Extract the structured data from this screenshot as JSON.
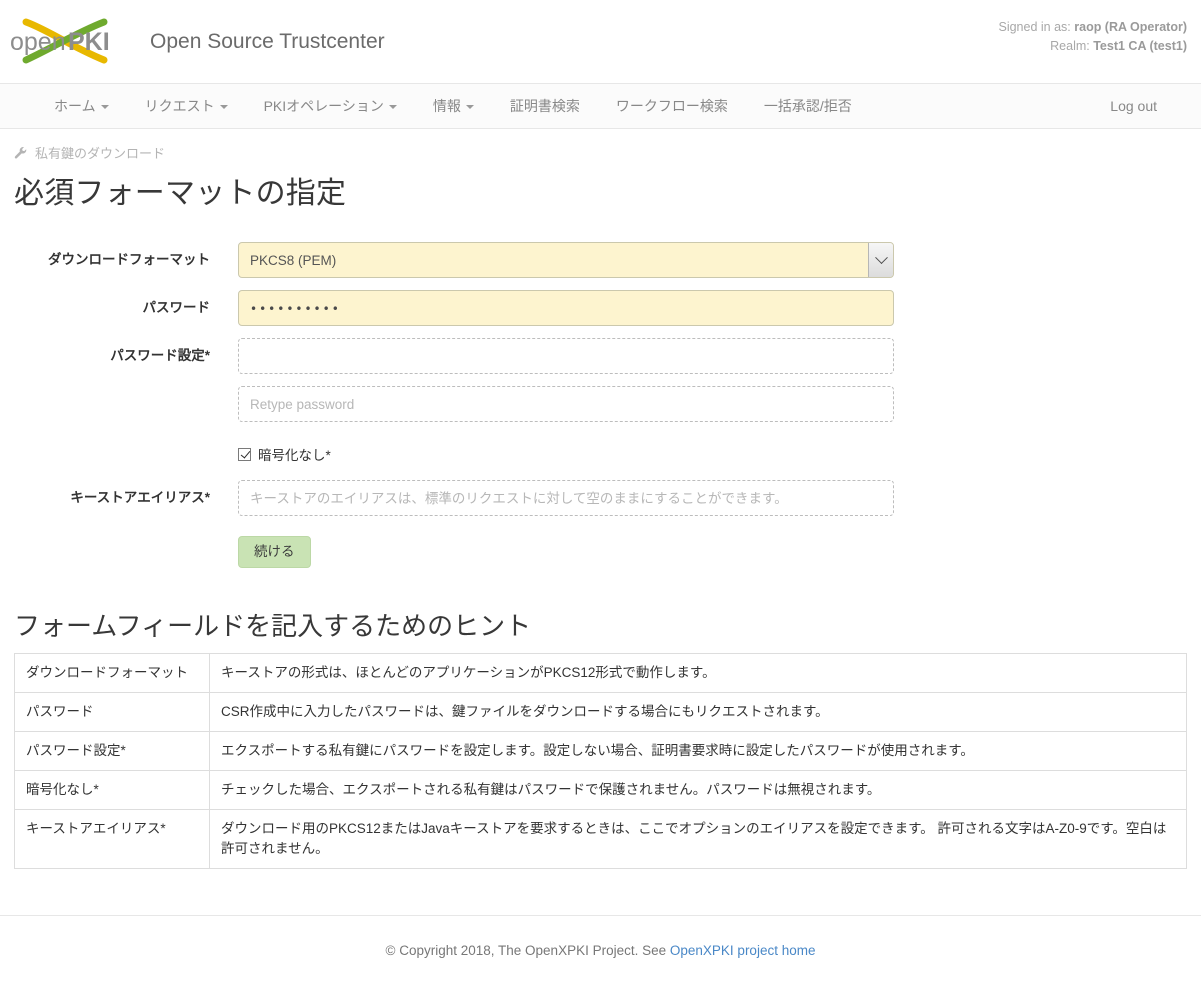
{
  "header": {
    "logo_alt": "openXPKI",
    "logo_text_open": "open",
    "logo_text_pki": "PKI",
    "brand_title": "Open Source Trustcenter",
    "signed_in_label": "Signed in as:",
    "signed_in_user": "raop (RA Operator)",
    "realm_label": "Realm:",
    "realm_value": "Test1 CA (test1)"
  },
  "nav": {
    "items": [
      {
        "label": "ホーム",
        "caret": true
      },
      {
        "label": "リクエスト",
        "caret": true
      },
      {
        "label": "PKIオペレーション",
        "caret": true
      },
      {
        "label": "情報",
        "caret": true
      },
      {
        "label": "証明書検索",
        "caret": false
      },
      {
        "label": "ワークフロー検索",
        "caret": false
      },
      {
        "label": "一括承認/拒否",
        "caret": false
      }
    ],
    "logout_label": "Log out"
  },
  "page": {
    "breadcrumb": "私有鍵のダウンロード",
    "title": "必須フォーマットの指定"
  },
  "form": {
    "download_format": {
      "label": "ダウンロードフォーマット",
      "value": "PKCS8 (PEM)",
      "options": [
        "PKCS8 (PEM)"
      ]
    },
    "password": {
      "label": "パスワード",
      "value": "••••••••••"
    },
    "set_password": {
      "label": "パスワード設定*",
      "value": "",
      "placeholder": ""
    },
    "retype_password": {
      "value": "",
      "placeholder": "Retype password"
    },
    "no_encryption": {
      "label": "暗号化なし*",
      "checked": true
    },
    "keystore_alias": {
      "label": "キーストアエイリアス*",
      "value": "",
      "placeholder": "キーストアのエイリアスは、標準のリクエストに対して空のままにすることができます。"
    },
    "submit_label": "続ける"
  },
  "hints": {
    "title": "フォームフィールドを記入するためのヒント",
    "rows": [
      {
        "key": "ダウンロードフォーマット",
        "value": "キーストアの形式は、ほとんどのアプリケーションがPKCS12形式で動作します。"
      },
      {
        "key": "パスワード",
        "value": "CSR作成中に入力したパスワードは、鍵ファイルをダウンロードする場合にもリクエストされます。"
      },
      {
        "key": "パスワード設定*",
        "value": "エクスポートする私有鍵にパスワードを設定します。設定しない場合、証明書要求時に設定したパスワードが使用されます。"
      },
      {
        "key": "暗号化なし*",
        "value": "チェックした場合、エクスポートされる私有鍵はパスワードで保護されません。パスワードは無視されます。"
      },
      {
        "key": "キーストアエイリアス*",
        "value": "ダウンロード用のPKCS12またはJavaキーストアを要求するときは、ここでオプションのエイリアスを設定できます。 許可される文字はA-Z0-9です。空白は許可されません。"
      }
    ]
  },
  "footer": {
    "text": "© Copyright 2018, The OpenXPKI Project. See",
    "link_label": "OpenXPKI project home"
  },
  "colors": {
    "autofill_yellow": "#fdf4cf",
    "button_green": "#c9e3b4",
    "link_blue": "#4a88c7",
    "nav_text": "#888888"
  }
}
